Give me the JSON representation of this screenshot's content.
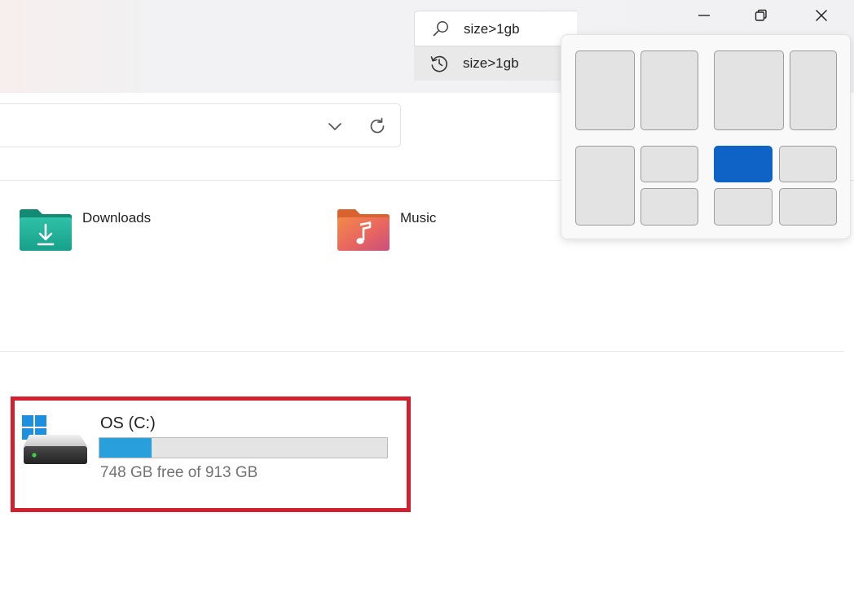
{
  "window_controls": {
    "minimize": "minimize-icon",
    "restore": "restore-icon",
    "close": "close-icon"
  },
  "address_bar": {
    "dropdown_icon": "chevron-down-icon",
    "refresh_icon": "refresh-icon"
  },
  "search": {
    "value": "size>1gb",
    "icon": "search-icon",
    "suggestion": {
      "text": "size>1gb",
      "icon": "history-icon"
    }
  },
  "folders": [
    {
      "label": "Downloads",
      "icon": "downloads-folder-icon",
      "color": "#1aa88e"
    },
    {
      "label": "Music",
      "icon": "music-folder-icon",
      "color": "#e66a58"
    }
  ],
  "drive": {
    "name": "OS (C:)",
    "free_text": "748 GB free of 913 GB",
    "used_fraction": 0.18,
    "bar_color": "#29a0dc",
    "highlight_color": "#d3202f",
    "icon": "hard-drive-icon",
    "logo": "windows-logo-icon"
  },
  "snap_layouts": {
    "accent_color": "#0f63c6",
    "active_zone": "layout-4-zone-top-left"
  }
}
